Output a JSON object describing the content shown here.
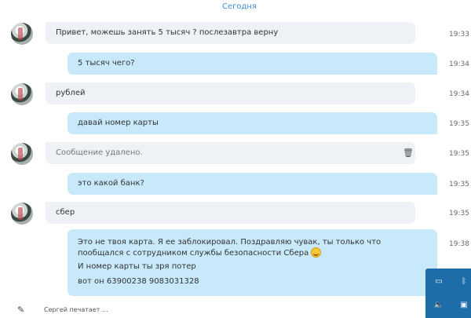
{
  "date_header": "Сегодня",
  "messages": [
    {
      "text": "Привет, можешь занять 5 тысяч ? послезавтра верну",
      "time": "19:33"
    },
    {
      "text": "5 тысяч чего?",
      "time": "19:34"
    },
    {
      "text": "рублей",
      "time": "19:34"
    },
    {
      "text": "давай номер карты",
      "time": "19:35"
    },
    {
      "text": "Сообщение удалено.",
      "time": "19:35"
    },
    {
      "text": "это какой банк?",
      "time": "19:35"
    },
    {
      "text": "сбер",
      "time": "19:35"
    }
  ],
  "long_message": {
    "line1": "Это не твоя карта. Я ее заблокировал. Поздравляю чувак, ты только что пообщался с сотрудником службы безопасности Сбера",
    "line2": "И номер карты ты зря потер",
    "line3": "вот он 63900238 9083031328",
    "time": "19:38"
  },
  "footer": {
    "typing_status": "Сергей печатает ..."
  },
  "tray": {
    "icons": [
      "battery-icon",
      "bluetooth-icon",
      "volume-icon",
      "network-icon"
    ]
  },
  "colors": {
    "accent": "#3b8fd6",
    "incoming_bubble": "#eef1f5",
    "outgoing_bubble": "#c8e9fa",
    "tray_background": "#1d6da8"
  }
}
